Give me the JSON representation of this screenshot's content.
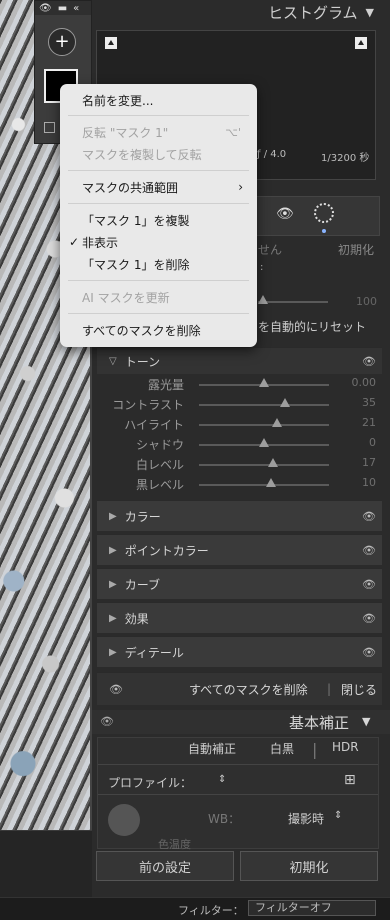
{
  "histogram": {
    "title": "ヒストグラム",
    "aperture": "ƒ / 4.0",
    "shutter": "1/3200 秒"
  },
  "mask_panel": {
    "add_label": "+"
  },
  "context_menu": {
    "rename": "名前を変更...",
    "invert": "反転 \"マスク 1\"",
    "invert_shortcut": "⌥'",
    "duplicate_invert": "マスクを複製して反転",
    "intersect": "マスクの共通範囲",
    "duplicate": "「マスク 1」を複製",
    "hide": "非表示",
    "delete": "「マスク 1」を削除",
    "ai_update": "AI マスクを更新",
    "delete_all": "すべてのマスクを削除"
  },
  "partial": {
    "left_text": "せん",
    "reset_btn": "初期化",
    "amount_val": "100",
    "auto_reset": "を自動的にリセット"
  },
  "tone": {
    "label": "トーン",
    "sliders": [
      {
        "label": "露光量",
        "value": "0.00",
        "pos": 0.5
      },
      {
        "label": "コントラスト",
        "value": "35",
        "pos": 0.66
      },
      {
        "label": "ハイライト",
        "value": "21",
        "pos": 0.6
      },
      {
        "label": "シャドウ",
        "value": "0",
        "pos": 0.5
      },
      {
        "label": "白レベル",
        "value": "17",
        "pos": 0.57
      },
      {
        "label": "黒レベル",
        "value": "10",
        "pos": 0.55
      }
    ]
  },
  "sections": [
    {
      "label": "カラー"
    },
    {
      "label": "ポイントカラー"
    },
    {
      "label": "カーブ"
    },
    {
      "label": "効果"
    },
    {
      "label": "ディテール"
    }
  ],
  "footer_row": {
    "delete_all": "すべてのマスクを削除",
    "close": "閉じる"
  },
  "basic": {
    "title": "基本補正",
    "auto": "自動補正",
    "bw": "白黒",
    "hdr": "HDR",
    "profile": "プロファイル：",
    "wb": "WB：",
    "wb_value": "撮影時",
    "tint_partial": "色温度"
  },
  "bottom": {
    "prev": "前の設定",
    "reset": "初期化"
  },
  "filter": {
    "label": "フィルター：",
    "value": "フィルターオフ"
  }
}
